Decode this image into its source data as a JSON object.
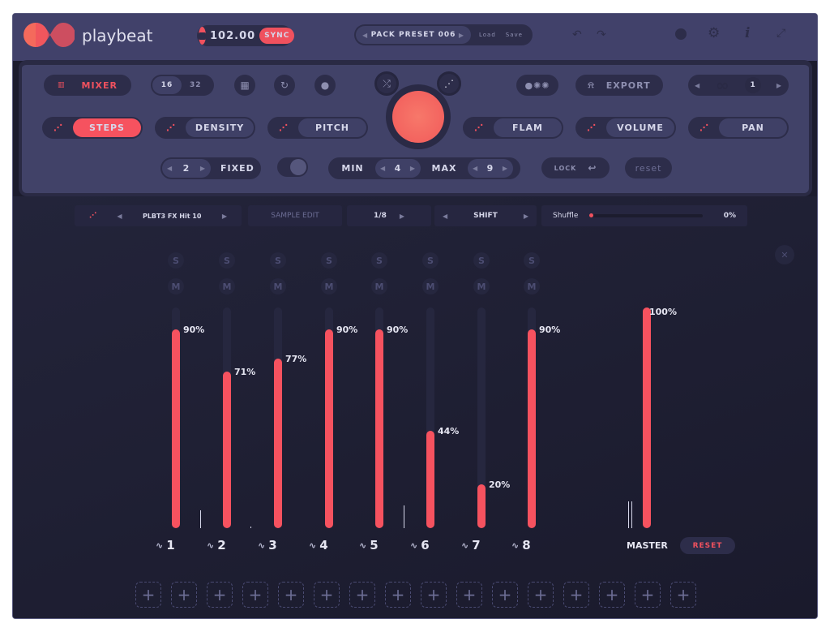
{
  "app": {
    "name": "playbeat"
  },
  "header": {
    "bpm": "102.00",
    "sync": "SYNC",
    "preset": "PACK PRESET 006",
    "load": "Load",
    "save": "Save",
    "icons": [
      "undo-icon",
      "redo-icon",
      "palette-icon",
      "gear-icon",
      "info-icon",
      "expand-icon"
    ]
  },
  "panel": {
    "mixer": "MIXER",
    "steps16": "16",
    "steps32": "32",
    "steps": "STEPS",
    "density": "DENSITY",
    "pitch": "PITCH",
    "flam": "FLAM",
    "volume": "VOLUME",
    "pan": "PAN",
    "export": "EXPORT",
    "loop_count": "1",
    "fixed_value": "2",
    "fixed": "FIXED",
    "min": "MIN",
    "min_value": "4",
    "max": "MAX",
    "max_value": "9",
    "lock": "LOCK",
    "reset": "reset"
  },
  "sample_bar": {
    "sample": "PLBT3 FX Hit 10",
    "sample_edit": "SAMPLE EDIT",
    "division": "1/8",
    "shift": "SHIFT",
    "shuffle": "Shuffle",
    "shuffle_value": "0%"
  },
  "mixer": {
    "solo": "S",
    "mute": "M",
    "channels": [
      {
        "label": "1",
        "volume": 90,
        "volume_text": "90%"
      },
      {
        "label": "2",
        "volume": 71,
        "volume_text": "71%"
      },
      {
        "label": "3",
        "volume": 77,
        "volume_text": "77%"
      },
      {
        "label": "4",
        "volume": 90,
        "volume_text": "90%"
      },
      {
        "label": "5",
        "volume": 90,
        "volume_text": "90%"
      },
      {
        "label": "6",
        "volume": 44,
        "volume_text": "44%"
      },
      {
        "label": "7",
        "volume": 20,
        "volume_text": "20%"
      },
      {
        "label": "8",
        "volume": 90,
        "volume_text": "90%"
      }
    ],
    "master": {
      "label": "MASTER",
      "volume": 100,
      "volume_text": "100%",
      "reset": "RESET"
    }
  },
  "slots": {
    "count": 16,
    "symbol": "+"
  },
  "colors": {
    "accent": "#f6525f",
    "bg": "#1c1c2e",
    "panel": "#414268"
  }
}
